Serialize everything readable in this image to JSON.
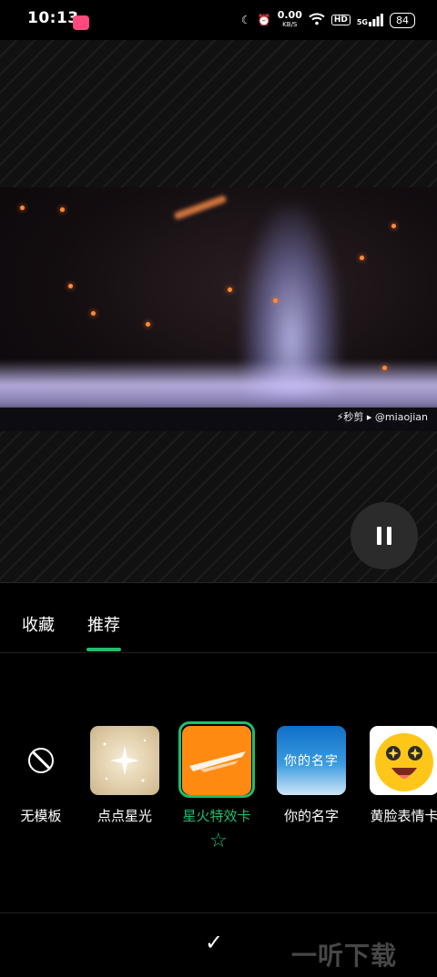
{
  "status_bar": {
    "time": "10:13",
    "net_speed": "0.00",
    "net_unit": "KB/S",
    "hd": "HD",
    "signal": "5G",
    "battery": "84"
  },
  "video": {
    "watermark": "⚡秒剪 ▸ @miaojian"
  },
  "tabs": [
    {
      "label": "收藏"
    },
    {
      "label": "推荐"
    }
  ],
  "templates": [
    {
      "label": "无模板"
    },
    {
      "label": "点点星光"
    },
    {
      "label": "星火特效卡"
    },
    {
      "label": "你的名字",
      "thumb_text": "你的名字"
    },
    {
      "label": "黄脸表情卡"
    }
  ],
  "colors": {
    "accent": "#1fbe6e",
    "background": "#000000"
  },
  "confirm_icon": "✓",
  "footer_watermark": "一听下载"
}
